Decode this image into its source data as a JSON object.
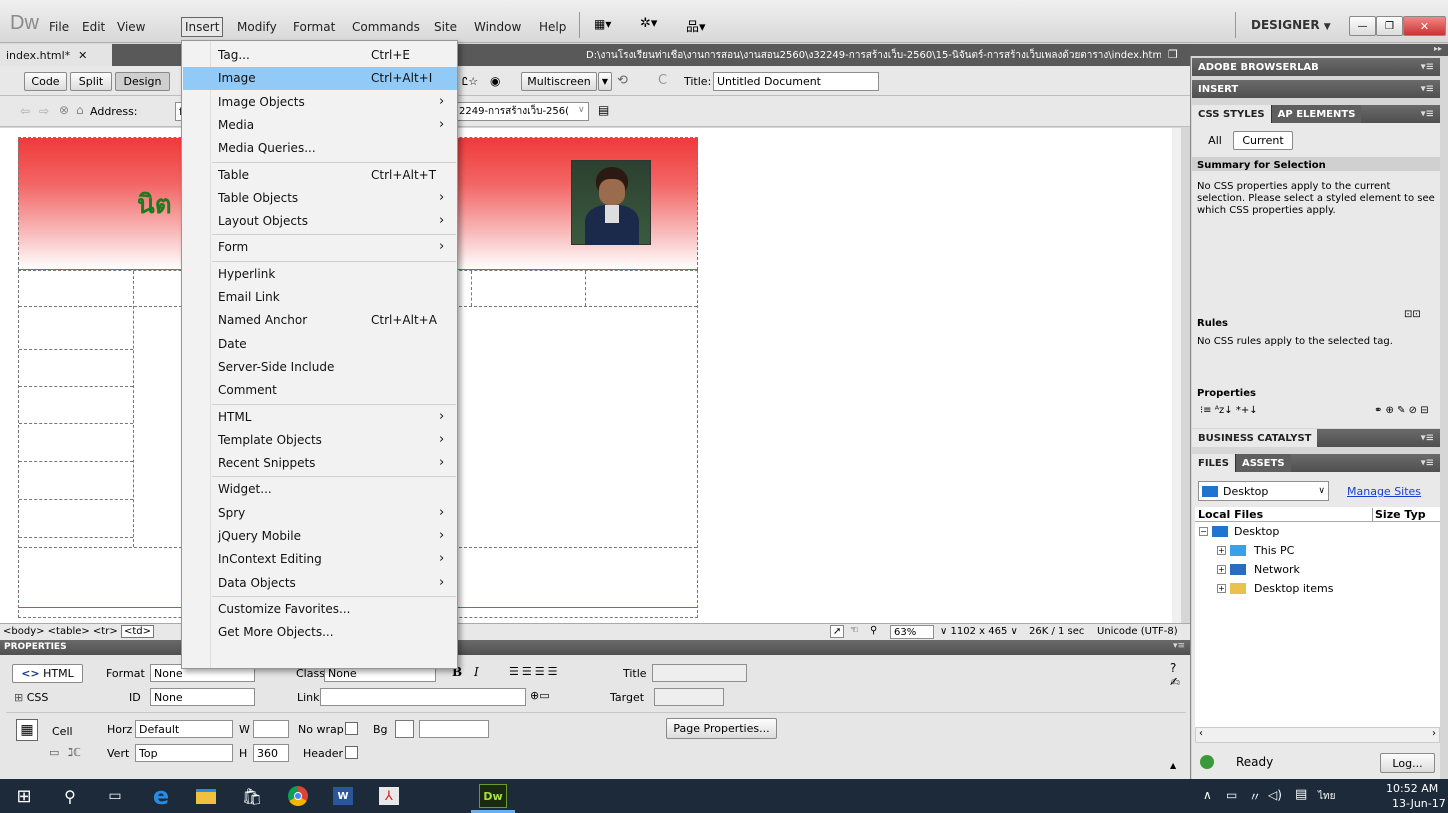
{
  "app": {
    "logo": "Dw",
    "menus": [
      "File",
      "Edit",
      "View",
      "Insert",
      "Modify",
      "Format",
      "Commands",
      "Site",
      "Window",
      "Help"
    ],
    "workspace": "DESIGNER",
    "workspace_arrow": "▼"
  },
  "document": {
    "tab": "index.html*",
    "path": "D:\\งานโรงเรียนท่าเชือ\\งานการสอน\\งานสอน2560\\ง32249-การสร้างเว็บ-2560\\15-นิจันตร์-การสร้างเว็บเพลงด้วยตาราง\\index.html",
    "view_buttons": [
      "Code",
      "Split",
      "Design"
    ],
    "multiscreen": "Multiscreen",
    "title_label": "Title:",
    "title_value": "Untitled Document",
    "address_label": "Address:",
    "address_value": "f",
    "address_rest": "2249-การสร้างเว็บ-256(",
    "heading_text": "นิต"
  },
  "status": {
    "tags": "<body> <table> <tr>",
    "tag_active": "<td>",
    "zoom": "63%",
    "size": "1102 x 465",
    "info": "26K / 1 sec",
    "encoding": "Unicode (UTF-8)"
  },
  "insert_menu": [
    {
      "label": "Tag...",
      "shortcut": "Ctrl+E"
    },
    {
      "label": "Image",
      "shortcut": "Ctrl+Alt+I",
      "highlight": true
    },
    {
      "label": "Image Objects",
      "arrow": true
    },
    {
      "label": "Media",
      "arrow": true
    },
    {
      "label": "Media Queries...",
      "sep_after": true
    },
    {
      "label": "Table",
      "shortcut": "Ctrl+Alt+T"
    },
    {
      "label": "Table Objects",
      "arrow": true
    },
    {
      "label": "Layout Objects",
      "arrow": true,
      "sep_after": true
    },
    {
      "label": "Form",
      "arrow": true,
      "sep_after": true
    },
    {
      "label": "Hyperlink"
    },
    {
      "label": "Email Link"
    },
    {
      "label": "Named Anchor",
      "shortcut": "Ctrl+Alt+A"
    },
    {
      "label": "Date"
    },
    {
      "label": "Server-Side Include"
    },
    {
      "label": "Comment",
      "sep_after": true
    },
    {
      "label": "HTML",
      "arrow": true
    },
    {
      "label": "Template Objects",
      "arrow": true
    },
    {
      "label": "Recent Snippets",
      "arrow": true,
      "sep_after": true
    },
    {
      "label": "Widget..."
    },
    {
      "label": "Spry",
      "arrow": true
    },
    {
      "label": "jQuery Mobile",
      "arrow": true
    },
    {
      "label": "InContext Editing",
      "arrow": true
    },
    {
      "label": "Data Objects",
      "arrow": true,
      "sep_after": true
    },
    {
      "label": "Customize Favorites..."
    },
    {
      "label": "Get More Objects..."
    }
  ],
  "properties": {
    "header": "PROPERTIES",
    "html_btn": "HTML",
    "css_btn": "CSS",
    "format_label": "Format",
    "format_value": "None",
    "class_label": "Class",
    "class_value": "None",
    "id_label": "ID",
    "id_value": "None",
    "link_label": "Link",
    "title_label": "Title",
    "target_label": "Target",
    "cell_label": "Cell",
    "horz_label": "Horz",
    "horz_value": "Default",
    "vert_label": "Vert",
    "vert_value": "Top",
    "w_label": "W",
    "h_label": "H",
    "h_value": "360",
    "nowrap_label": "No wrap",
    "bg_label": "Bg",
    "header_label": "Header",
    "page_props": "Page Properties..."
  },
  "panels": {
    "browserlab": "ADOBE BROWSERLAB",
    "insert": "INSERT",
    "css_styles": "CSS STYLES",
    "ap_elements": "AP ELEMENTS",
    "all": "All",
    "current": "Current",
    "summary_title": "Summary for Selection",
    "summary_text": "No CSS properties apply to the current selection.  Please select a styled element to see which CSS properties apply.",
    "rules_title": "Rules",
    "rules_text": "No CSS rules apply to the selected tag.",
    "properties_title": "Properties",
    "business_catalyst": "BUSINESS CATALYST",
    "files": "FILES",
    "assets": "ASSETS",
    "site_select": "Desktop",
    "manage_sites": "Manage Sites",
    "local_files": "Local Files",
    "size_type": "Size Typ",
    "tree": [
      "Desktop",
      "This PC",
      "Network",
      "Desktop items"
    ],
    "ready": "Ready",
    "log": "Log..."
  },
  "taskbar": {
    "time": "10:52 AM",
    "date": "13-Jun-17",
    "lang": "ไทย",
    "dw": "Dw"
  }
}
